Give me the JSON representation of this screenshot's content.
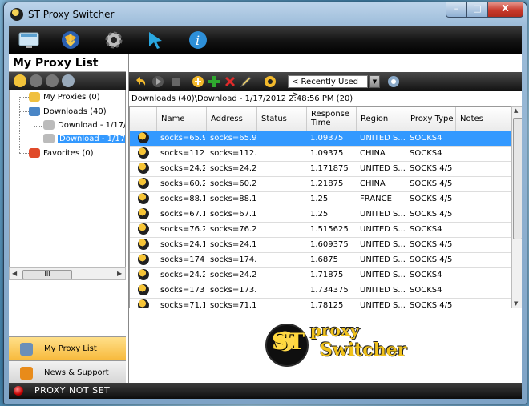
{
  "window": {
    "title": "ST Proxy Switcher"
  },
  "main_toolbar": {
    "icons": [
      "monitor-icon",
      "download-globe-icon",
      "gear-icon",
      "pointer-arrow-icon",
      "info-icon"
    ]
  },
  "left_pane": {
    "title": "My Proxy List",
    "tree": {
      "my_proxies": "My Proxies (0)",
      "downloads": "Downloads (40)",
      "download_1": "Download - 1/17/",
      "download_2": "Download - 1/17/",
      "favorites": "Favorites (0)"
    },
    "scroll_thumb": "III",
    "nav": {
      "my_proxy_list": "My Proxy List",
      "news_support": "News & Support"
    }
  },
  "right_pane": {
    "filter_value": "< Recently Used >",
    "path": "Downloads (40)\\Download - 1/17/2012 2:48:56 PM (20)",
    "columns": [
      "Name",
      "Address",
      "Status",
      "Response Time",
      "Region",
      "Proxy Type",
      "Notes"
    ],
    "rows": [
      [
        "socks=65.9....",
        "socks=65.9....",
        "",
        "1.09375",
        "UNITED S...",
        "SOCKS4",
        ""
      ],
      [
        "socks=112....",
        "socks=112....",
        "",
        "1.09375",
        "CHINA",
        "SOCKS4",
        ""
      ],
      [
        "socks=24.2...",
        "socks=24.2...",
        "",
        "1.171875",
        "UNITED S...",
        "SOCKS 4/5",
        ""
      ],
      [
        "socks=60.2...",
        "socks=60.2...",
        "",
        "1.21875",
        "CHINA",
        "SOCKS 4/5",
        ""
      ],
      [
        "socks=88.1...",
        "socks=88.1...",
        "",
        "1.25",
        "FRANCE",
        "SOCKS 4/5",
        ""
      ],
      [
        "socks=67.1...",
        "socks=67.1...",
        "",
        "1.25",
        "UNITED S...",
        "SOCKS 4/5",
        ""
      ],
      [
        "socks=76.2...",
        "socks=76.2...",
        "",
        "1.515625",
        "UNITED S...",
        "SOCKS4",
        ""
      ],
      [
        "socks=24.1...",
        "socks=24.1...",
        "",
        "1.609375",
        "UNITED S...",
        "SOCKS 4/5",
        ""
      ],
      [
        "socks=174....",
        "socks=174....",
        "",
        "1.6875",
        "UNITED S...",
        "SOCKS 4/5",
        ""
      ],
      [
        "socks=24.2...",
        "socks=24.2...",
        "",
        "1.71875",
        "UNITED S...",
        "SOCKS4",
        ""
      ],
      [
        "socks=173....",
        "socks=173....",
        "",
        "1.734375",
        "UNITED S...",
        "SOCKS4",
        ""
      ],
      [
        "socks=71.1...",
        "socks=71.1...",
        "",
        "1.78125",
        "UNITED S...",
        "SOCKS 4/5",
        ""
      ]
    ],
    "logo": {
      "line1": "proxy",
      "line2": "Switcher",
      "mark": "ST"
    }
  },
  "status": {
    "text": "PROXY NOT SET"
  },
  "colors": {
    "selection": "#3399ff",
    "status_red": "#c00000",
    "nav_active": "#f7b93b"
  }
}
